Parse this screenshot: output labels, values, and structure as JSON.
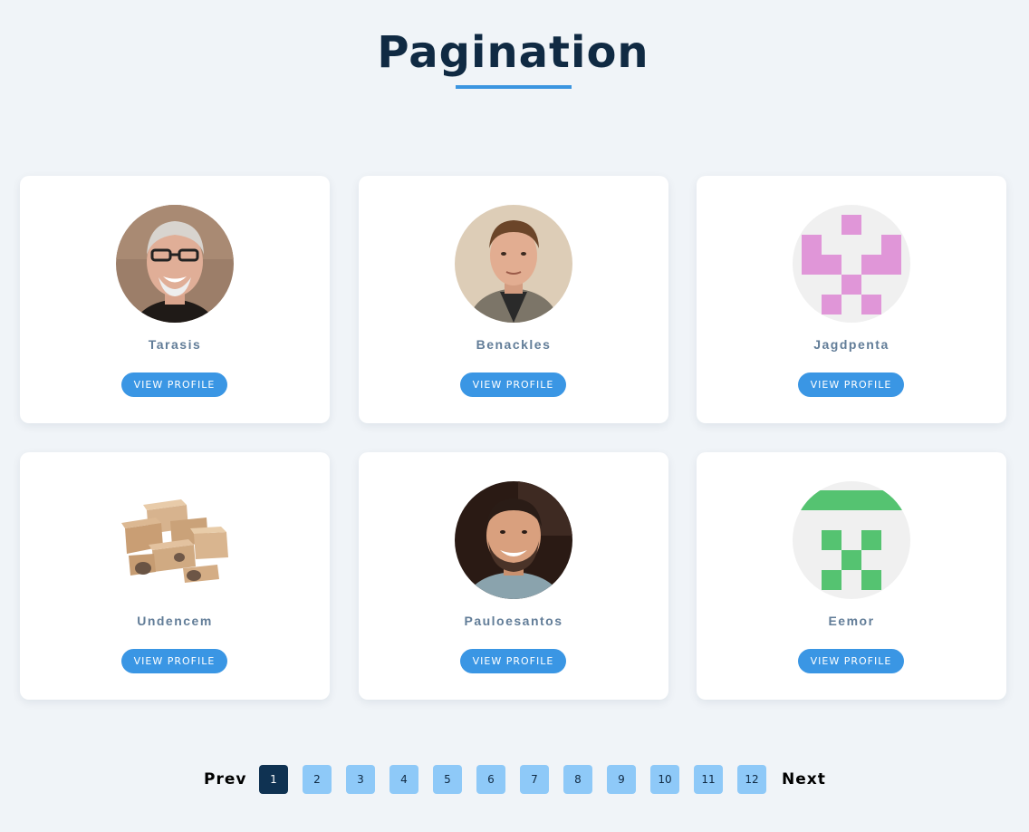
{
  "page": {
    "title": "Pagination"
  },
  "cards": [
    {
      "name": "Tarasis",
      "button": "VIEW PROFILE",
      "avatar_icon": "photo-older-man-glasses"
    },
    {
      "name": "Benackles",
      "button": "VIEW PROFILE",
      "avatar_icon": "photo-young-man"
    },
    {
      "name": "Jagdpenta",
      "button": "VIEW PROFILE",
      "avatar_icon": "identicon-pink",
      "accent": "#e096d8"
    },
    {
      "name": "Undencem",
      "button": "VIEW PROFILE",
      "avatar_icon": "photo-cardboard-boxes"
    },
    {
      "name": "Pauloesantos",
      "button": "VIEW PROFILE",
      "avatar_icon": "photo-bearded-man"
    },
    {
      "name": "Eemor",
      "button": "VIEW PROFILE",
      "avatar_icon": "identicon-green",
      "accent": "#55c371"
    }
  ],
  "pagination": {
    "prev": "Prev",
    "next": "Next",
    "pages": [
      "1",
      "2",
      "3",
      "4",
      "5",
      "6",
      "7",
      "8",
      "9",
      "10",
      "11",
      "12"
    ],
    "current": "1"
  },
  "colors": {
    "background": "#f0f4f8",
    "title": "#102a43",
    "accent": "#3a96e4",
    "page_inactive": "#8ec9f8",
    "page_active": "#0f3252"
  }
}
